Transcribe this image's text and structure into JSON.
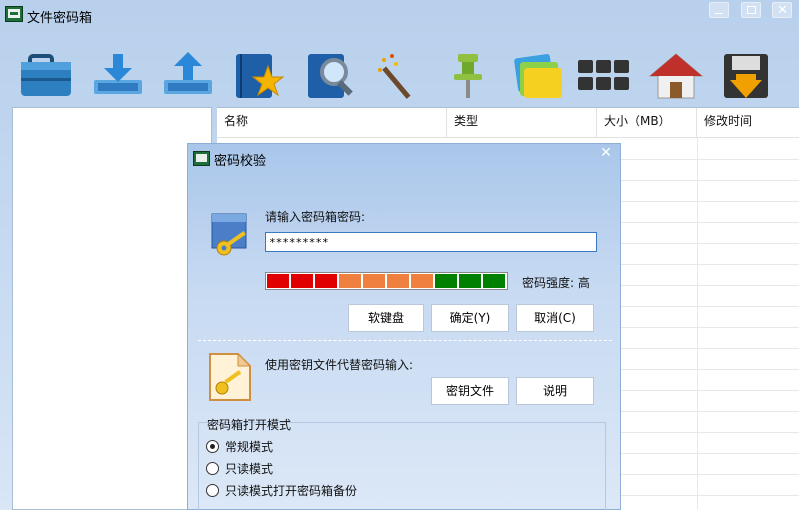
{
  "window": {
    "title": "文件密码箱"
  },
  "filelist": {
    "columns": [
      "名称",
      "类型",
      "大小（MB）",
      "修改时间"
    ]
  },
  "dialog": {
    "title": "密码校验",
    "prompt": "请输入密码箱密码:",
    "password_value": "*********",
    "strength_label": "密码强度: 高",
    "strength_segments": [
      "#e00000",
      "#e00000",
      "#e00000",
      "#f08040",
      "#f08040",
      "#f08040",
      "#f08040",
      "#008000",
      "#008000",
      "#008000"
    ],
    "buttons": {
      "soft_keyboard": "软键盘",
      "ok": "确定(Y)",
      "cancel": "取消(C)",
      "key_file": "密钥文件",
      "help": "说明"
    },
    "alt_prompt": "使用密钥文件代替密码输入:",
    "mode_group": {
      "label": "密码箱打开模式",
      "options": [
        {
          "label": "常规模式",
          "selected": true
        },
        {
          "label": "只读模式",
          "selected": false
        },
        {
          "label": "只读模式打开密码箱备份",
          "selected": false
        }
      ]
    }
  },
  "toolbar": {
    "icons": [
      "toolbox-icon",
      "download-icon",
      "upload-icon",
      "notebook-star-icon",
      "search-book-icon",
      "magic-wand-icon",
      "pin-icon",
      "folders-icon",
      "grid-icon",
      "home-icon",
      "save-icon"
    ]
  }
}
